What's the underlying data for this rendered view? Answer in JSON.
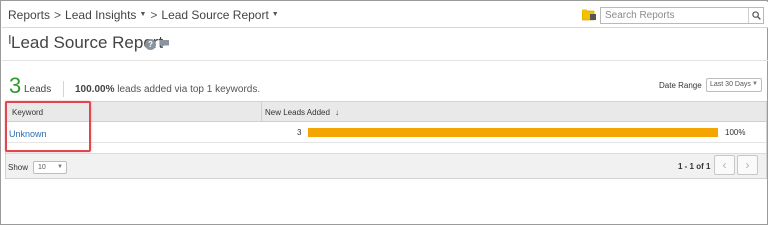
{
  "breadcrumb": {
    "items": [
      "Reports",
      "Lead Insights",
      "Lead Source Report"
    ],
    "separator": ">"
  },
  "search": {
    "placeholder": "Search Reports"
  },
  "page": {
    "title": "Lead Source Report"
  },
  "summary": {
    "count": "3",
    "count_label": "Leads",
    "percent": "100.00%",
    "text": " leads added via top 1 keywords."
  },
  "filters": {
    "date_range_label": "Date Range",
    "date_range_value": "Last 30 Days"
  },
  "table": {
    "columns": [
      "Keyword",
      "New Leads Added"
    ],
    "rows": [
      {
        "keyword": "Unknown",
        "count": "3",
        "percent_label": "100%",
        "fraction": 1.0
      }
    ]
  },
  "footer": {
    "show_label": "Show",
    "page_size": "10",
    "range_text": "1 - 1 of 1"
  },
  "colors": {
    "accent_green": "#2e9a2e",
    "bar_orange": "#f5a500",
    "link_blue": "#2a6fb5",
    "highlight_red": "#e0464b"
  }
}
